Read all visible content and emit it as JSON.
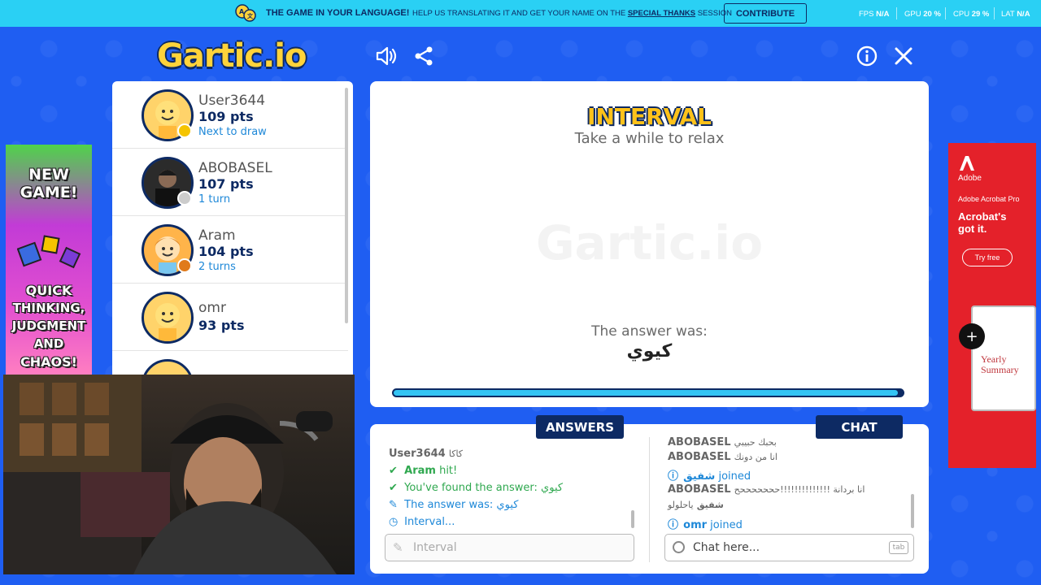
{
  "topbar": {
    "promo_title": "THE GAME IN YOUR LANGUAGE!",
    "promo_text_before": "HELP US TRANSLATING IT AND GET YOUR NAME ON THE",
    "promo_link": "SPECIAL THANKS",
    "promo_text_after": "SESSION",
    "contribute_label": "CONTRIBUTE",
    "fps_label": "FPS",
    "fps_value": "N/A",
    "gpu_label": "GPU",
    "gpu_value": "20 %",
    "cpu_label": "CPU",
    "cpu_value": "29 %",
    "lat_label": "LAT",
    "lat_value": "N/A"
  },
  "header": {
    "logo": "Gartic.io",
    "icons": [
      "speaker-icon",
      "share-icon",
      "info-icon",
      "close-icon"
    ]
  },
  "players": [
    {
      "name": "User3644",
      "points": "109 pts",
      "sub": "Next to draw",
      "dot_color": "#f5c400"
    },
    {
      "name": "ABOBASEL",
      "points": "107 pts",
      "sub": "1 turn",
      "dot_color": "#cccccc"
    },
    {
      "name": "Aram",
      "points": "104 pts",
      "sub": "2 turns",
      "dot_color": "#e07a1a"
    },
    {
      "name": "omr",
      "points": "93 pts",
      "sub": ""
    }
  ],
  "canvas": {
    "title": "INTERVAL",
    "subtitle": "Take a while to relax",
    "watermark": "Gartic.io",
    "answer_label": "The answer was:",
    "answer_word": "كيوي",
    "progress": 0.99
  },
  "answers": {
    "tab_label": "ANSWERS",
    "messages": [
      {
        "type": "user",
        "name": "User3644",
        "text": "كاكا"
      },
      {
        "type": "hit",
        "name": "Aram",
        "text": "hit!"
      },
      {
        "type": "found",
        "text": "You've found the answer: كيوي"
      },
      {
        "type": "answer",
        "text": "The answer was: كيوي"
      },
      {
        "type": "interval",
        "text": "Interval..."
      }
    ],
    "input_placeholder": "Interval"
  },
  "chat": {
    "tab_label": "CHAT",
    "messages": [
      {
        "type": "user",
        "name": "ABOBASEL",
        "text": "بحبك حبيبي"
      },
      {
        "type": "user",
        "name": "ABOBASEL",
        "text": "انا من دونك"
      },
      {
        "type": "join",
        "name": "شفيق",
        "text": "joined"
      },
      {
        "type": "user",
        "name": "ABOBASEL",
        "text": "انا بردانة !!!!!!!!!!!!!!حححححححح"
      },
      {
        "type": "user",
        "name": "شفيق",
        "text": "ياحلولو"
      },
      {
        "type": "join",
        "name": "omr",
        "text": "joined"
      }
    ],
    "input_placeholder": "Chat here...",
    "tab_hint": "tab"
  },
  "ads": {
    "left": {
      "line1": "NEW",
      "line2": "GAME!",
      "line3": "QUICK",
      "line4": "THINKING,",
      "line5": "JUDGMENT",
      "line6": "AND",
      "line7": "CHAOS!"
    },
    "right": {
      "brand": "Adobe",
      "product": "Adobe Acrobat Pro",
      "headline1": "Acrobat's",
      "headline2": "got it.",
      "cta": "Try free",
      "doc_title1": "Yearly",
      "doc_title2": "Summary"
    }
  },
  "colors": {
    "accent": "#0d2a63",
    "background": "#1f5ef2",
    "topbar": "#2ad0f4",
    "title_yellow": "#ffc21a"
  }
}
